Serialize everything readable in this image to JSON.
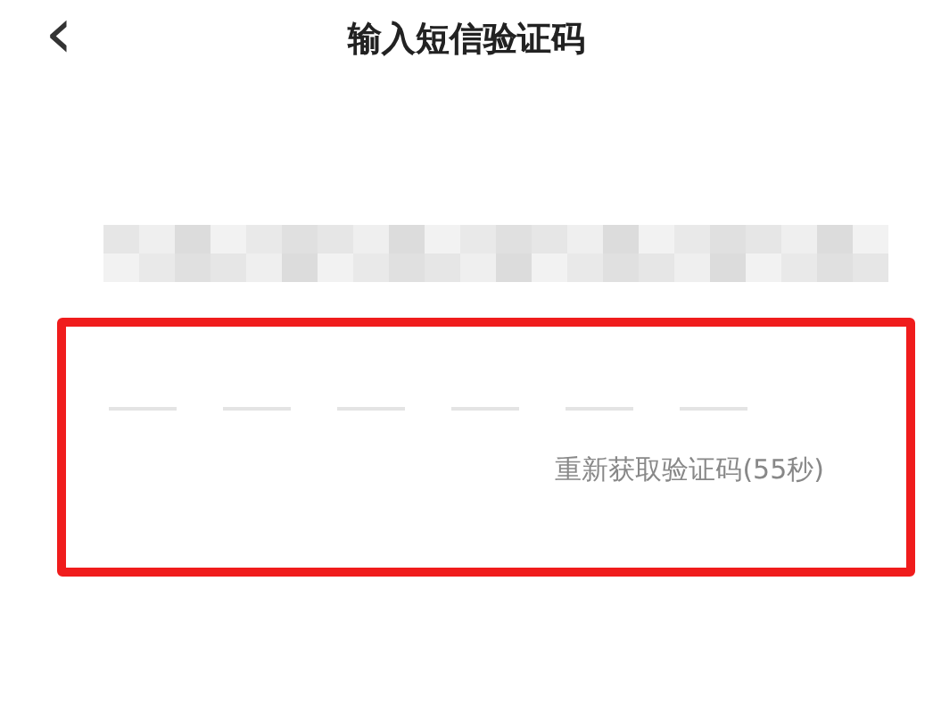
{
  "header": {
    "back_icon": "‹",
    "title": "输入短信验证码"
  },
  "code_slots": [
    {
      "filled": false
    },
    {
      "filled": false
    },
    {
      "filled": false
    },
    {
      "filled": false
    },
    {
      "filled": false
    },
    {
      "filled": false
    }
  ],
  "resend": {
    "label": "重新获取验证码(55秒)",
    "disabled": true
  }
}
